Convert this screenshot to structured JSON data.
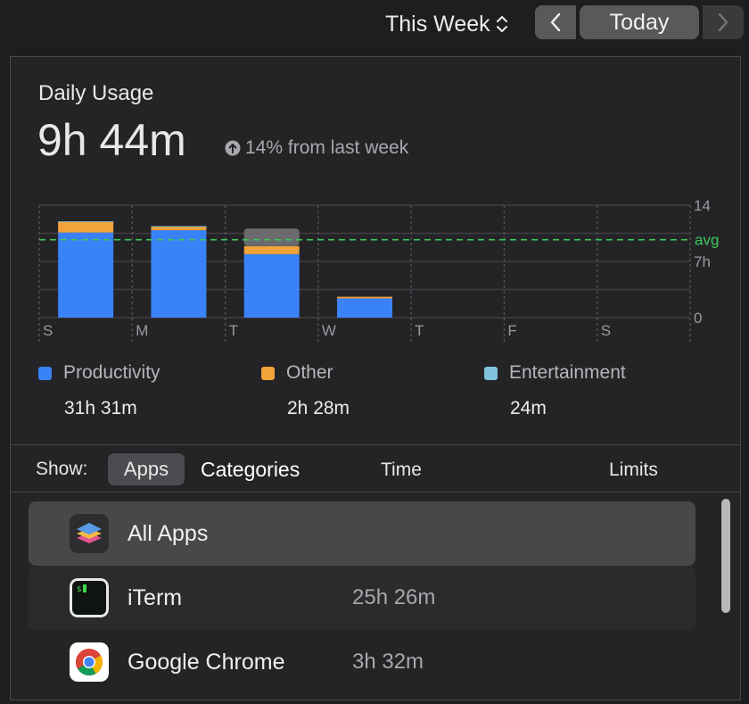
{
  "toolbar": {
    "period_label": "This Week",
    "prev_icon": "chevron-left-icon",
    "today_label": "Today",
    "next_icon": "chevron-right-icon"
  },
  "usage": {
    "title": "Daily Usage",
    "total": "9h 44m",
    "change_icon": "arrow-up-circle-icon",
    "change_text": "14% from last week"
  },
  "chart_data": {
    "type": "bar",
    "stacked": true,
    "categories": [
      "S",
      "M",
      "T",
      "W",
      "T",
      "F",
      "S"
    ],
    "series": [
      {
        "name": "Productivity",
        "color": "#3a82f7",
        "values": [
          10.6,
          10.9,
          7.9,
          2.4,
          0,
          0,
          0
        ]
      },
      {
        "name": "Other",
        "color": "#f2a33a",
        "values": [
          1.3,
          0.4,
          1.0,
          0.2,
          0,
          0,
          0
        ]
      },
      {
        "name": "Entertainment",
        "color": "#81c3db",
        "values": [
          0.1,
          0.1,
          0,
          0,
          0,
          0,
          0
        ]
      }
    ],
    "selected_bar_extra": {
      "category_index": 2,
      "value": 2.2,
      "color": "#6b6b6e"
    },
    "y_ticks": [
      "14",
      "7h",
      "0"
    ],
    "y_tick_values": [
      14,
      7,
      0
    ],
    "ylim": [
      0,
      14
    ],
    "average_label": "avg",
    "average_value": 9.7,
    "grid": true
  },
  "legend": [
    {
      "label": "Productivity",
      "value": "31h 31m",
      "color": "#3a82f7"
    },
    {
      "label": "Other",
      "value": "2h 28m",
      "color": "#f2a33a"
    },
    {
      "label": "Entertainment",
      "value": "24m",
      "color": "#81c3db"
    }
  ],
  "show_bar": {
    "label": "Show:",
    "apps_label": "Apps",
    "categories_label": "Categories",
    "time_header": "Time",
    "limits_header": "Limits"
  },
  "apps": [
    {
      "name": "All Apps",
      "time": "",
      "icon": "all-apps-stack-icon",
      "selected": true
    },
    {
      "name": "iTerm",
      "time": "25h 26m",
      "icon": "iterm-icon",
      "selected": false
    },
    {
      "name": "Google Chrome",
      "time": "3h 32m",
      "icon": "chrome-icon",
      "selected": false
    }
  ]
}
